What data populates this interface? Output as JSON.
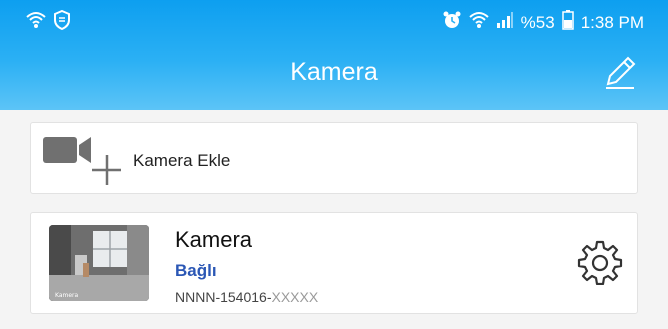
{
  "status_bar": {
    "battery": "%53",
    "time": "1:38 PM"
  },
  "header": {
    "title": "Kamera"
  },
  "add_camera": {
    "label": "Kamera Ekle"
  },
  "camera": {
    "name": "Kamera",
    "status": "Bağlı",
    "id_prefix": "NNNN-154016-",
    "id_suffix": "XXXXX",
    "thumbnail_caption": "Kamera"
  },
  "colors": {
    "header_top": "#0d9ff0",
    "header_bottom": "#5cc4f7",
    "status_text": "#2b57b5",
    "background": "#f4f4f4"
  },
  "icons": {
    "status_left": [
      "wifi-icon",
      "shield-icon"
    ],
    "status_right": [
      "alarm-icon",
      "wifi-icon",
      "signal-icon",
      "battery-icon"
    ],
    "header_action": "pencil-icon",
    "add_camera": "video-camera-plus-icon",
    "settings": "gear-icon"
  }
}
